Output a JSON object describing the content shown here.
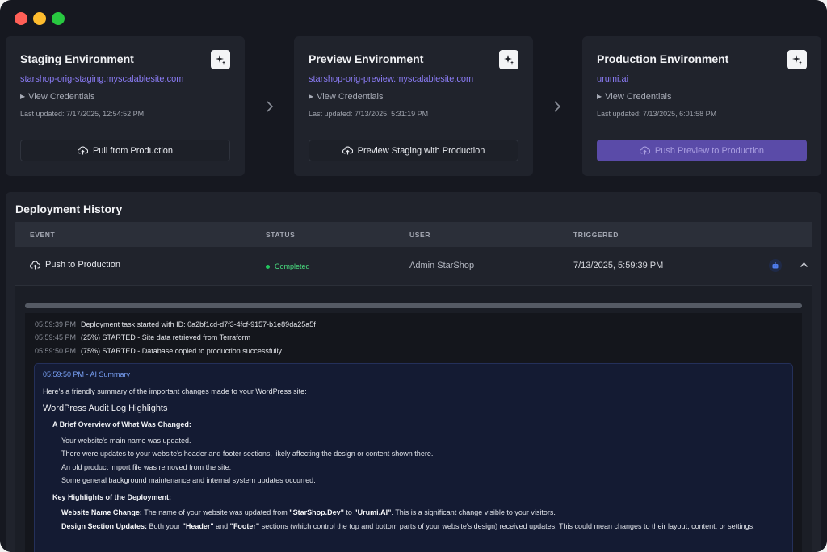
{
  "environments": [
    {
      "title": "Staging Environment",
      "url": "starshop-orig-staging.myscalablesite.com",
      "credentials_label": "View Credentials",
      "last_updated": "Last updated: 7/17/2025, 12:54:52 PM",
      "button_label": "Pull from Production"
    },
    {
      "title": "Preview Environment",
      "url": "starshop-orig-preview.myscalablesite.com",
      "credentials_label": "View Credentials",
      "last_updated": "Last updated: 7/13/2025, 5:31:19 PM",
      "button_label": "Preview Staging with Production"
    },
    {
      "title": "Production Environment",
      "url": "urumi.ai",
      "credentials_label": "View Credentials",
      "last_updated": "Last updated: 7/13/2025, 6:01:58 PM",
      "button_label": "Push Preview to Production"
    }
  ],
  "history": {
    "title": "Deployment History",
    "columns": [
      "EVENT",
      "STATUS",
      "USER",
      "TRIGGERED"
    ],
    "row": {
      "event": "Push to Production",
      "status": "Completed",
      "user": "Admin StarShop",
      "triggered": "7/13/2025, 5:59:39 PM"
    },
    "progress_fraction": 1.0,
    "logs": [
      {
        "time": "05:59:39 PM",
        "text": "Deployment task started with ID: 0a2bf1cd-d7f3-4fcf-9157-b1e89da25a5f"
      },
      {
        "time": "05:59:45 PM",
        "text": "(25%) STARTED - Site data retrieved from Terraform"
      },
      {
        "time": "05:59:50 PM",
        "text": "(75%) STARTED - Database copied to production successfully"
      }
    ],
    "summary": {
      "header": "05:59:50 PM - AI Summary",
      "intro": "Here's a friendly summary of the important changes made to your WordPress site:",
      "heading": "WordPress Audit Log Highlights",
      "overview_heading": "A Brief Overview of What Was Changed:",
      "overview_items": [
        "Your website's main name was updated.",
        "There were updates to your website's header and footer sections, likely affecting the design or content shown there.",
        "An old product import file was removed from the site.",
        "Some general background maintenance and internal system updates occurred."
      ],
      "highlights_heading": "Key Highlights of the Deployment:",
      "hl1_label": "Website Name Change:",
      "hl1_pre": "The name of your website was updated from ",
      "hl1_from": "\"StarShop.Dev\"",
      "hl1_mid": " to ",
      "hl1_to": "\"Urumi.AI\"",
      "hl1_post": ". This is a significant change visible to your visitors.",
      "hl2_label": "Design Section Updates:",
      "hl2_pre": "Both your ",
      "hl2_header": "\"Header\"",
      "hl2_and": " and ",
      "hl2_footer": "\"Footer\"",
      "hl2_post": " sections (which control the top and bottom parts of your website's design) received updates. This could mean changes to their layout, content, or settings."
    }
  },
  "colors": {
    "accent": "#8b7cf6",
    "primary_button": "#5a4ba8",
    "success": "#22c55e",
    "summary_link": "#7aa2f7"
  },
  "icons": [
    "sparkle-icon",
    "chevron-right-icon",
    "cloud-upload-icon",
    "caret-right-icon",
    "chevron-up-icon",
    "bot-icon"
  ]
}
